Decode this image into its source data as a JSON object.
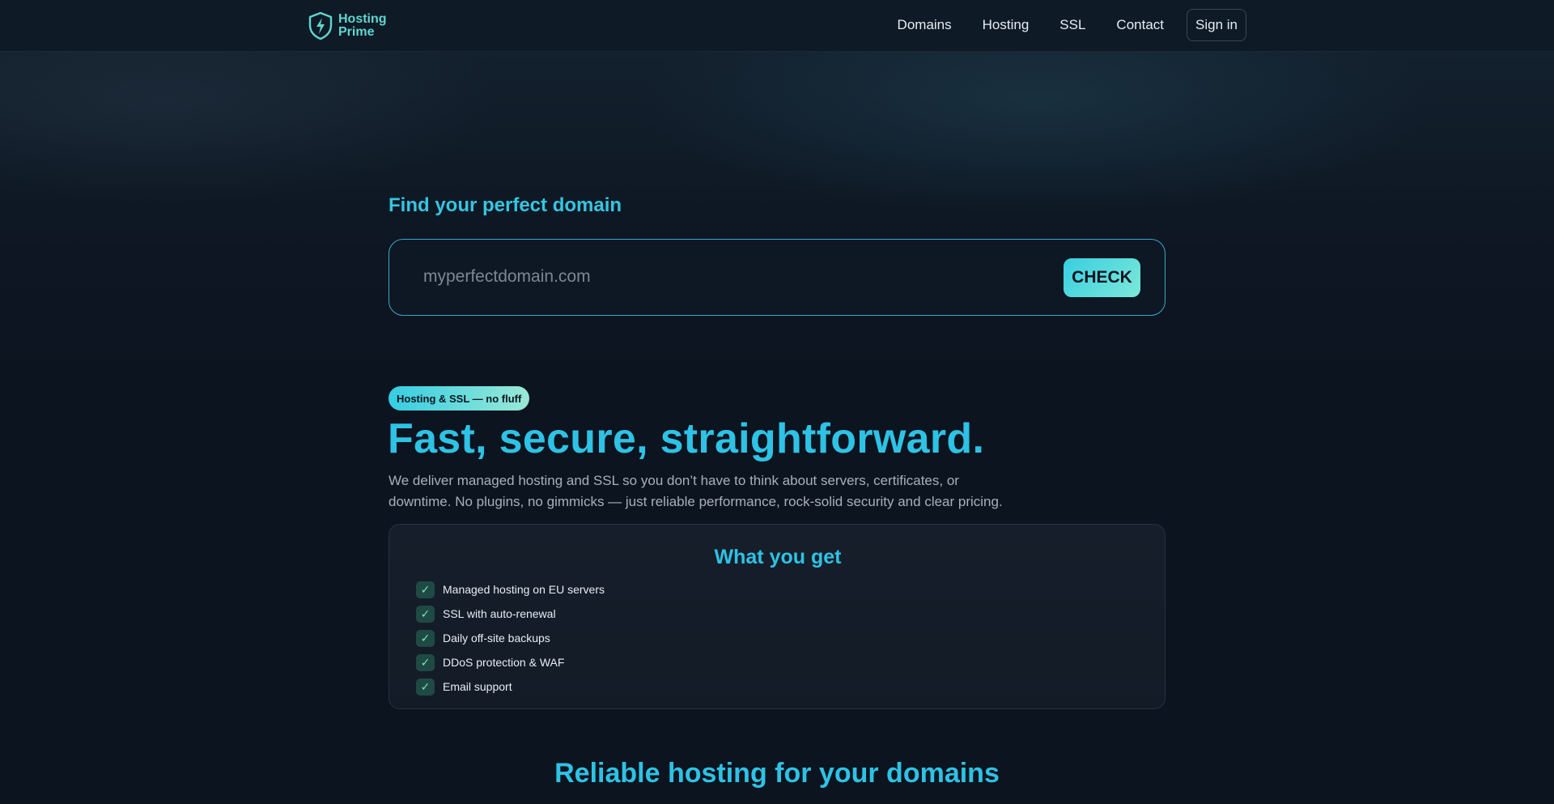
{
  "brand": {
    "name_line1": "Hosting",
    "name_line2": "Prime"
  },
  "nav": {
    "items": [
      {
        "label": "Domains"
      },
      {
        "label": "Hosting"
      },
      {
        "label": "SSL"
      },
      {
        "label": "Contact"
      }
    ],
    "signin_label": "Sign in"
  },
  "search": {
    "title": "Find your perfect domain",
    "placeholder": "myperfectdomain.com",
    "value": "",
    "button_label": "CHECK"
  },
  "hero": {
    "badge": "Hosting & SSL — no fluff",
    "title": "Fast, secure, straightforward.",
    "description": "We deliver managed hosting and SSL so you don’t have to think about servers, certificates, or downtime. No plugins, no gimmicks — just reliable performance, rock-solid security and clear pricing."
  },
  "features_card": {
    "title": "What you get",
    "items": [
      {
        "icon": "check-icon",
        "label": "Managed hosting on EU servers"
      },
      {
        "icon": "check-icon",
        "label": "SSL with auto-renewal"
      },
      {
        "icon": "check-icon",
        "label": "Daily off-site backups"
      },
      {
        "icon": "check-icon",
        "label": "DDoS protection & WAF"
      },
      {
        "icon": "check-icon",
        "label": "Email support"
      }
    ]
  },
  "next_section": {
    "title": "Reliable hosting for your domains"
  },
  "colors": {
    "accent": "#2ec2e4",
    "background": "#0c1420",
    "logo": "#5fd6cf"
  }
}
